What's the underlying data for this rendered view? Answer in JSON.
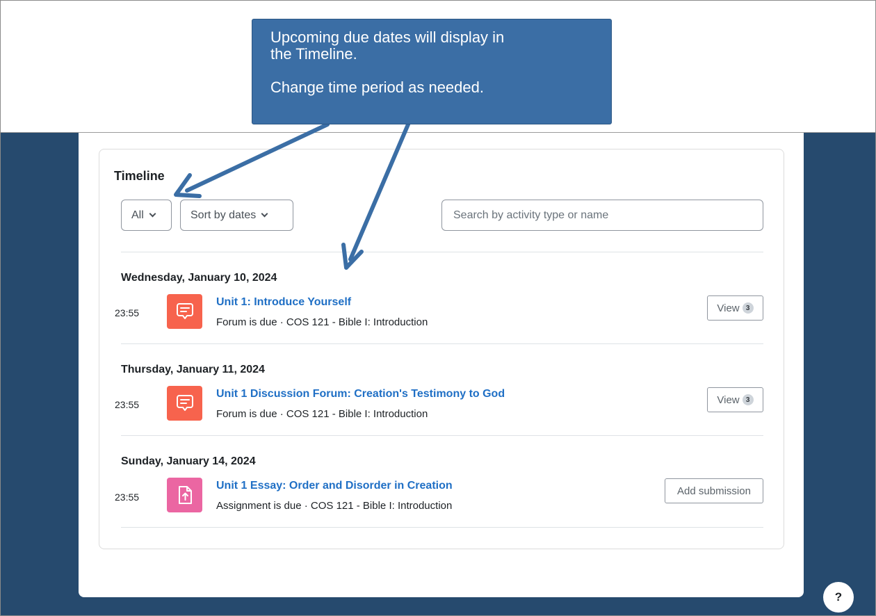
{
  "callout": {
    "line1": "Upcoming due dates will display in",
    "line2": "the Timeline.",
    "line3": "Change time period as needed."
  },
  "timeline": {
    "title": "Timeline",
    "filter_label": "All",
    "sort_label": "Sort by dates",
    "search_placeholder": "Search by activity type or name",
    "groups": [
      {
        "date": "Wednesday, January 10, 2024",
        "time": "23:55",
        "icon": "forum-icon",
        "title": "Unit 1: Introduce Yourself",
        "meta": "Forum is due · COS 121 - Bible I: Introduction",
        "action_label": "View",
        "action_count": "3"
      },
      {
        "date": "Thursday, January 11, 2024",
        "time": "23:55",
        "icon": "forum-icon",
        "title": "Unit 1 Discussion Forum: Creation's Testimony to God",
        "meta": "Forum is due · COS 121 - Bible I: Introduction",
        "action_label": "View",
        "action_count": "3"
      },
      {
        "date": "Sunday, January 14, 2024",
        "time": "23:55",
        "icon": "assignment-upload-icon",
        "title": "Unit 1 Essay: Order and Disorder in Creation",
        "meta": "Assignment is due · COS 121 - Bible I: Introduction",
        "action_label": "Add submission"
      }
    ]
  },
  "help_label": "?",
  "colors": {
    "navy_background": "#264a6e",
    "callout_blue": "#3b6ea5",
    "forum_icon_bg": "#f7634d",
    "assignment_icon_bg": "#eb66a2",
    "link_blue": "#1f6fc5"
  }
}
